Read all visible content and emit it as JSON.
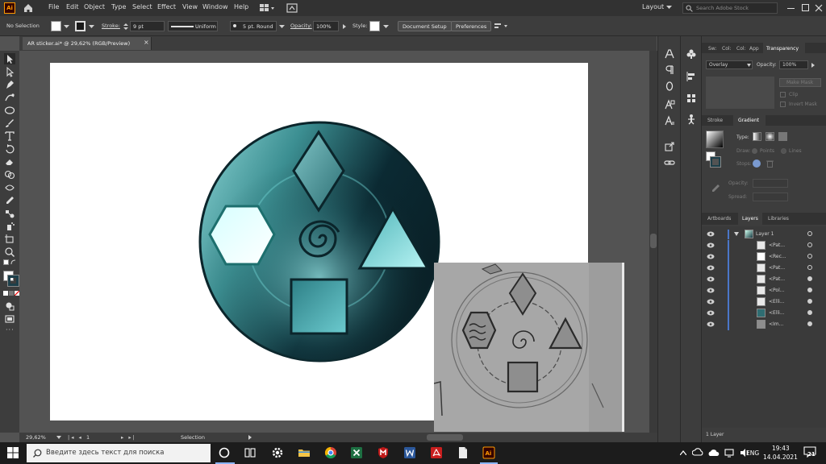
{
  "app": {
    "logo_text": "Ai",
    "menus": [
      "File",
      "Edit",
      "Object",
      "Type",
      "Select",
      "Effect",
      "View",
      "Window",
      "Help"
    ],
    "workspace": "Layout",
    "stock_search_placeholder": "Search Adobe Stock"
  },
  "control_bar": {
    "selection": "No Selection",
    "stroke_label": "Stroke:",
    "stroke_value": "9 pt",
    "profile": "Uniform",
    "brush": "5 pt. Round",
    "opacity_label": "Opacity:",
    "opacity_value": "100%",
    "style_label": "Style:",
    "document_setup": "Document Setup",
    "preferences": "Preferences"
  },
  "document": {
    "tab_title": "AR sticker.ai* @ 29,62% (RGB/Preview)",
    "close_glyph": "×"
  },
  "status_bar": {
    "zoom": "29,62%",
    "artboard_number": "1",
    "tool": "Selection"
  },
  "transparency_panel": {
    "tabs": [
      "Sw:",
      "Col:",
      "Col:",
      "App",
      "Transparency"
    ],
    "blend_mode": "Overlay",
    "opacity_label": "Opacity:",
    "opacity_value": "100%",
    "make_mask": "Make Mask",
    "clip": "Clip",
    "invert_mask": "Invert Mask"
  },
  "gradient_panel": {
    "tabs": [
      "Stroke",
      "Gradient"
    ],
    "type_label": "Type:",
    "draw_label": "Draw:",
    "points_label": "Points",
    "lines_label": "Lines",
    "stops_label": "Stops:",
    "opacity_label": "Opacity:",
    "spread_label": "Spread:"
  },
  "layers_panel": {
    "tabs": [
      "Artboards",
      "Layers",
      "Libraries"
    ],
    "layer_name": "Layer 1",
    "sublayers": [
      "<Pat...",
      "<Rec...",
      "<Pat...",
      "<Pat...",
      "<Pol...",
      "<Elli...",
      "<Elli...",
      "<Im..."
    ],
    "footer": "1 Layer"
  },
  "taskbar": {
    "search_placeholder": "Введите здесь текст для поиска",
    "language": "ENG",
    "time": "19:43",
    "date": "14.04.2021",
    "notifications": "21"
  },
  "colors": {
    "ui_dark": "#323232",
    "ui_panel": "#3d3d3d",
    "canvas": "#535353",
    "accent_blue": "#4a76c9",
    "teal_dark": "#0d2a30",
    "teal_mid": "#3f8f93",
    "teal_light": "#c9fbfb"
  }
}
